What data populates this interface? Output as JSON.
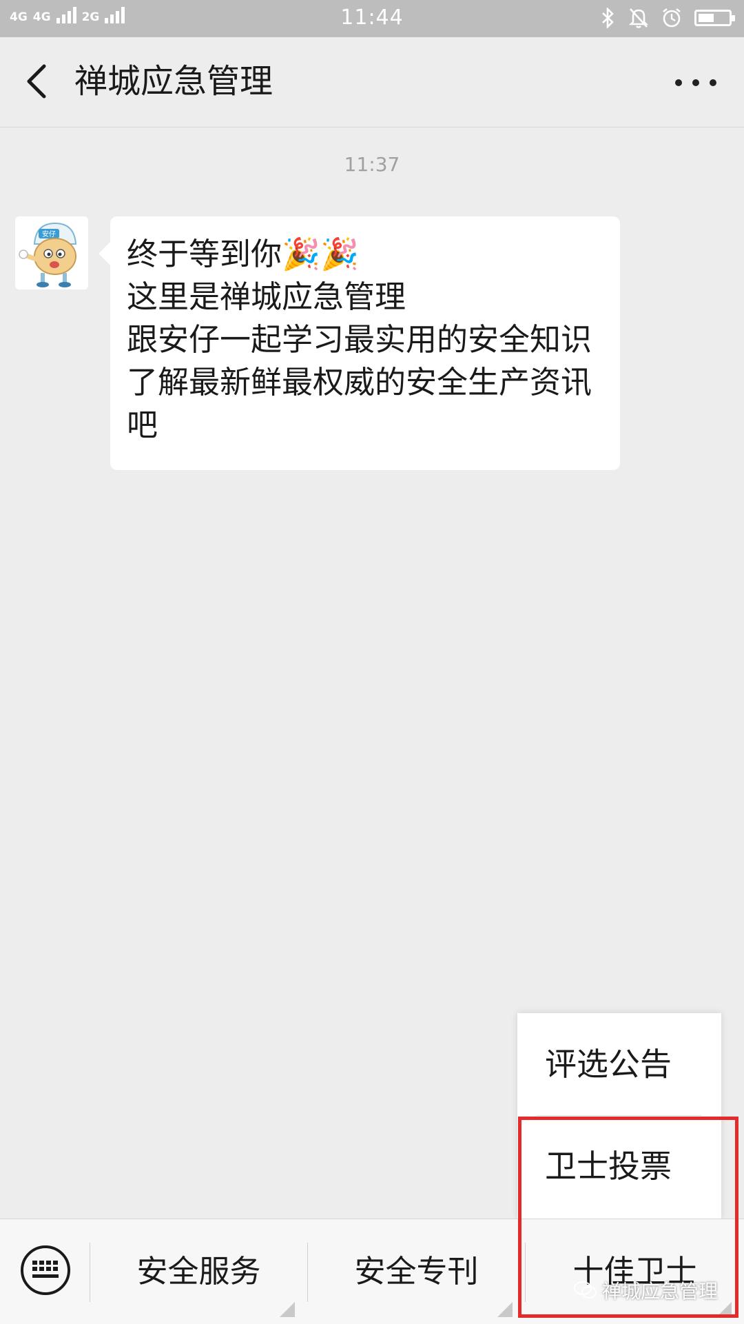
{
  "status_bar": {
    "network_left": "4G",
    "network_mid": "4G",
    "network_right": "2G",
    "time": "11:44"
  },
  "header": {
    "title": "禅城应急管理"
  },
  "chat": {
    "timestamp": "11:37",
    "message": {
      "line1": "终于等到你🎉🎉",
      "line2": "这里是禅城应急管理",
      "line3": "跟安仔一起学习最实用的安全知识",
      "line4": "了解最新鲜最权威的安全生产资讯",
      "line5": "吧"
    },
    "avatar_badge": "安仔"
  },
  "popup_menu": {
    "items": [
      {
        "label": "评选公告"
      },
      {
        "label": "卫士投票"
      }
    ]
  },
  "bottom_menu": {
    "items": [
      {
        "label": "安全服务"
      },
      {
        "label": "安全专刊"
      },
      {
        "label": "十佳卫士"
      }
    ]
  },
  "watermark": "禅城应急管理",
  "colors": {
    "background": "#ededed",
    "highlight": "#e42b2b",
    "bubble": "#ffffff"
  }
}
